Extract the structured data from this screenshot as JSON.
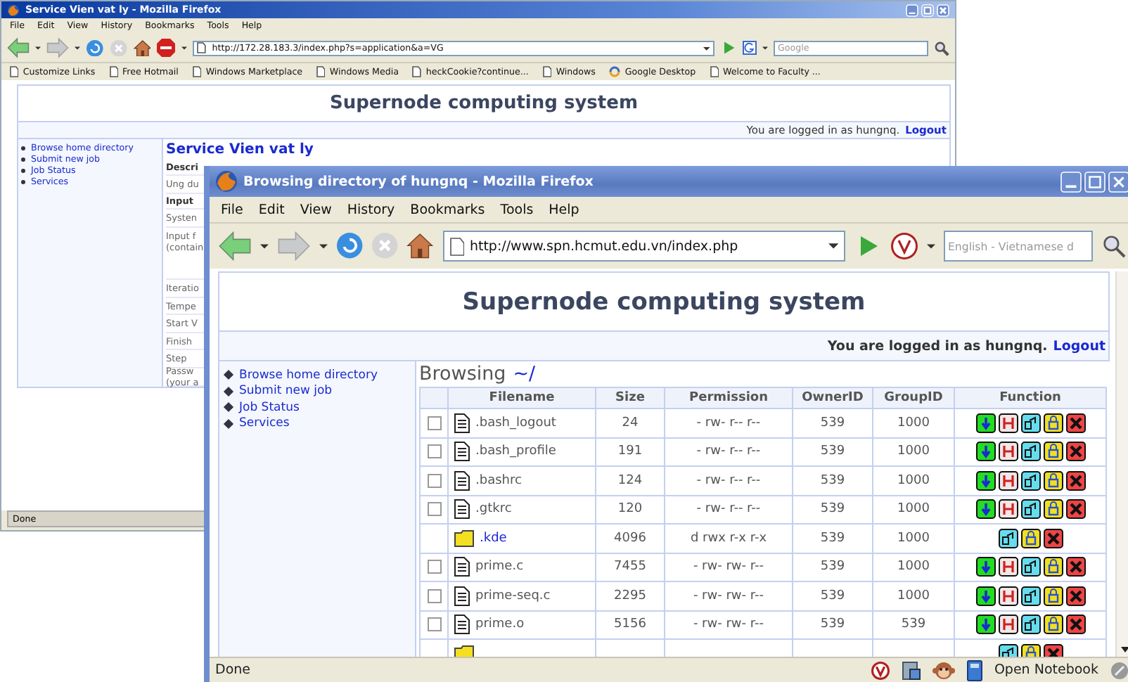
{
  "back_window": {
    "title": "Service Vien vat ly - Mozilla Firefox",
    "menu": [
      "File",
      "Edit",
      "View",
      "History",
      "Bookmarks",
      "Tools",
      "Help"
    ],
    "url": "http://172.28.183.3/index.php?s=application&a=VG",
    "search_placeholder": "Google",
    "bookmarks": [
      {
        "label": "Customize Links",
        "kind": "page"
      },
      {
        "label": "Free Hotmail",
        "kind": "page"
      },
      {
        "label": "Windows Marketplace",
        "kind": "page"
      },
      {
        "label": "Windows Media",
        "kind": "page"
      },
      {
        "label": "heckCookie?continue...",
        "kind": "page"
      },
      {
        "label": "Windows",
        "kind": "page"
      },
      {
        "label": "Google Desktop",
        "kind": "swirl"
      },
      {
        "label": "Welcome to Faculty ...",
        "kind": "page"
      }
    ],
    "heading": "Supernode computing system",
    "login_text": "You are logged in as hungnq.",
    "logout": "Logout",
    "sidebar": [
      "Browse home directory",
      "Submit new job",
      "Job Status",
      "Services"
    ],
    "panel_title": "Service Vien vat ly",
    "panel_rows": [
      {
        "kind": "section",
        "lines": [
          "Descri"
        ]
      },
      {
        "kind": "field",
        "lines": [
          "Ung du"
        ]
      },
      {
        "kind": "section",
        "lines": [
          "Input"
        ]
      },
      {
        "kind": "field",
        "lines": [
          "Systen"
        ]
      },
      {
        "kind": "tall",
        "lines": [
          "Input f",
          "(contain"
        ]
      },
      {
        "kind": "field",
        "lines": [
          "Iteratio"
        ]
      },
      {
        "kind": "field",
        "lines": [
          "Tempe"
        ]
      },
      {
        "kind": "field",
        "lines": [
          "Start V"
        ]
      },
      {
        "kind": "field",
        "lines": [
          "Finish"
        ]
      },
      {
        "kind": "field",
        "lines": [
          "Step"
        ]
      },
      {
        "kind": "field",
        "lines": [
          "Passw",
          "(your a"
        ]
      }
    ],
    "status": "Done"
  },
  "front_window": {
    "title": "Browsing directory of hungnq - Mozilla Firefox",
    "menu": [
      "File",
      "Edit",
      "View",
      "History",
      "Bookmarks",
      "Tools",
      "Help"
    ],
    "url": "http://www.spn.hcmut.edu.vn/index.php",
    "search_placeholder": "English - Vietnamese d",
    "heading": "Supernode computing system",
    "login_text": "You are logged in as hungnq.",
    "logout": "Logout",
    "sidebar": [
      "Browse home directory",
      "Submit new job",
      "Job Status",
      "Services"
    ],
    "browsing_label": "Browsing",
    "path": "~/",
    "table": {
      "columns": [
        "Filename",
        "Size",
        "Permission",
        "OwnerID",
        "GroupID",
        "Function"
      ],
      "rows": [
        {
          "kind": "file",
          "checked": false,
          "name": ".bash_logout",
          "size": "24",
          "permission": "- rw- r-- r--",
          "owner": "539",
          "group": "1000",
          "actions": [
            {
              "kind": "download"
            },
            {
              "kind": "rename"
            },
            {
              "kind": "move"
            },
            {
              "kind": "lock"
            },
            {
              "kind": "delete"
            }
          ]
        },
        {
          "kind": "file",
          "checked": false,
          "name": ".bash_profile",
          "size": "191",
          "permission": "- rw- r-- r--",
          "owner": "539",
          "group": "1000",
          "actions": [
            {
              "kind": "download"
            },
            {
              "kind": "rename"
            },
            {
              "kind": "move"
            },
            {
              "kind": "lock"
            },
            {
              "kind": "delete"
            }
          ]
        },
        {
          "kind": "file",
          "checked": false,
          "name": ".bashrc",
          "size": "124",
          "permission": "- rw- r-- r--",
          "owner": "539",
          "group": "1000",
          "actions": [
            {
              "kind": "download"
            },
            {
              "kind": "rename"
            },
            {
              "kind": "move"
            },
            {
              "kind": "lock"
            },
            {
              "kind": "delete"
            }
          ]
        },
        {
          "kind": "file",
          "checked": false,
          "name": ".gtkrc",
          "size": "120",
          "permission": "- rw- r-- r--",
          "owner": "539",
          "group": "1000",
          "actions": [
            {
              "kind": "download"
            },
            {
              "kind": "rename"
            },
            {
              "kind": "move"
            },
            {
              "kind": "lock"
            },
            {
              "kind": "delete"
            }
          ]
        },
        {
          "kind": "folder",
          "name": ".kde",
          "size": "4096",
          "permission": "d rwx r-x r-x",
          "owner": "539",
          "group": "1000",
          "actions": [
            {
              "kind": "move"
            },
            {
              "kind": "lock"
            },
            {
              "kind": "delete"
            }
          ]
        },
        {
          "kind": "file",
          "checked": false,
          "name": "prime.c",
          "size": "7455",
          "permission": "- rw- rw- r--",
          "owner": "539",
          "group": "1000",
          "actions": [
            {
              "kind": "download"
            },
            {
              "kind": "rename"
            },
            {
              "kind": "move"
            },
            {
              "kind": "lock"
            },
            {
              "kind": "delete"
            }
          ]
        },
        {
          "kind": "file",
          "checked": false,
          "name": "prime-seq.c",
          "size": "2295",
          "permission": "- rw- rw- r--",
          "owner": "539",
          "group": "1000",
          "actions": [
            {
              "kind": "download"
            },
            {
              "kind": "rename"
            },
            {
              "kind": "move"
            },
            {
              "kind": "lock"
            },
            {
              "kind": "delete"
            }
          ]
        },
        {
          "kind": "file",
          "checked": false,
          "name": "prime.o",
          "size": "5156",
          "permission": "- rw- rw- r--",
          "owner": "539",
          "group": "539",
          "actions": [
            {
              "kind": "download"
            },
            {
              "kind": "rename"
            },
            {
              "kind": "move"
            },
            {
              "kind": "lock"
            },
            {
              "kind": "delete"
            }
          ]
        },
        {
          "kind": "folder",
          "actions": [
            {
              "kind": "move"
            },
            {
              "kind": "lock"
            },
            {
              "kind": "delete"
            }
          ]
        }
      ]
    },
    "status": "Done",
    "notebook": "Open Notebook"
  }
}
